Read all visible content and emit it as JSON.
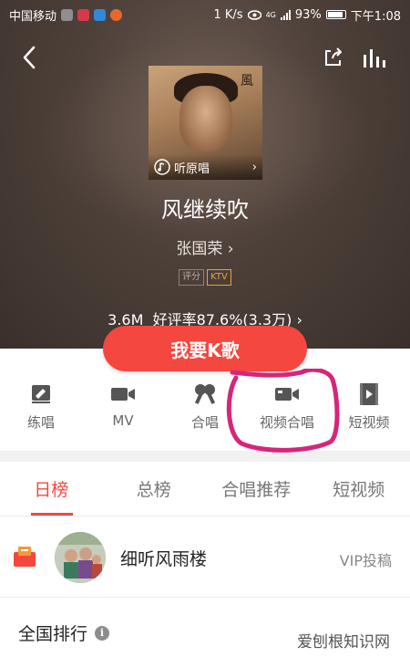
{
  "status_bar": {
    "carrier": "中国移动",
    "speed": "1 K/s",
    "network": "4G",
    "battery": "93%",
    "time": "下午1:08"
  },
  "nav": {
    "back_icon": "chevron-left-icon",
    "share_icon": "share-icon",
    "chart_icon": "equalizer-icon"
  },
  "song": {
    "cover_label": "听原唱",
    "title": "风继续吹",
    "artist": "张国荣",
    "tags": [
      "评分",
      "KTV"
    ],
    "stats": "3.6M  好评率87.6%(3.3万)"
  },
  "sing_button": "我要K歌",
  "actions": [
    {
      "label": "练唱",
      "icon": "practice-icon"
    },
    {
      "label": "MV",
      "icon": "video-camera-icon"
    },
    {
      "label": "合唱",
      "icon": "duet-icon"
    },
    {
      "label": "视频合唱",
      "icon": "video-duet-icon"
    },
    {
      "label": "短视频",
      "icon": "short-video-icon"
    }
  ],
  "tabs": [
    {
      "label": "日榜",
      "active": true
    },
    {
      "label": "总榜",
      "active": false
    },
    {
      "label": "合唱推荐",
      "active": false
    },
    {
      "label": "短视频",
      "active": false
    }
  ],
  "vip": {
    "name": "细听风雨楼",
    "tag": "VIP投稿"
  },
  "ranking": {
    "title": "全国排行",
    "info": "i"
  },
  "watermark": "爱刨根知识网",
  "colors": {
    "accent": "#f4473f",
    "annotation": "#d7257a",
    "ktv_tag": "#e8a13c"
  }
}
